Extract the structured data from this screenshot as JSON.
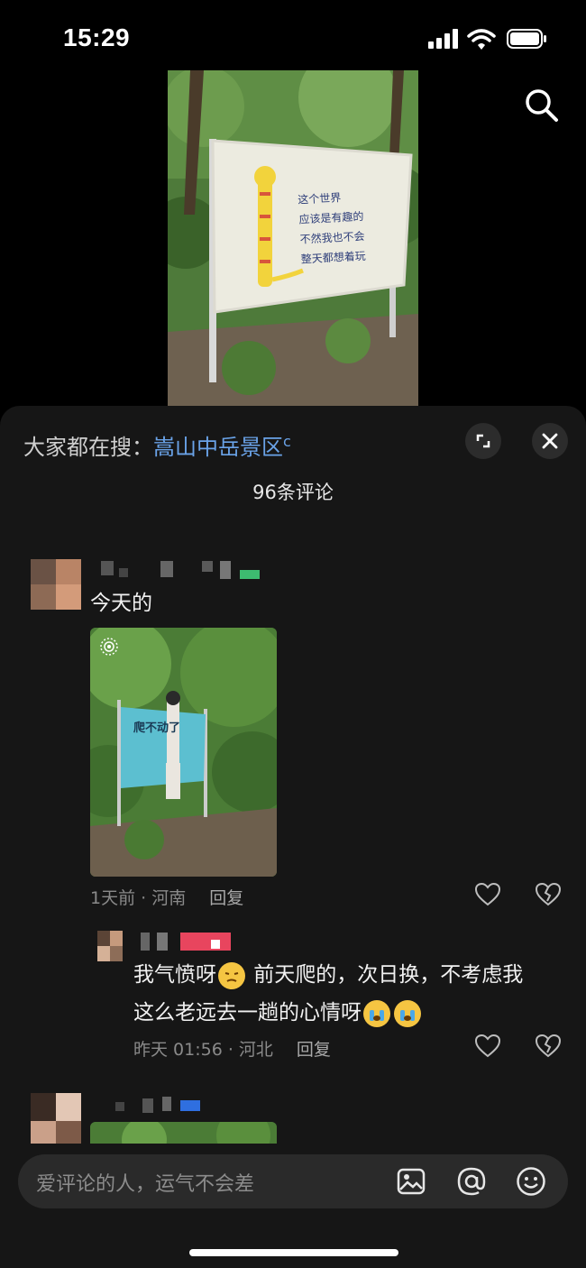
{
  "status_bar": {
    "time": "15:29"
  },
  "header": {
    "hot_search_prefix": "大家都在搜：",
    "hot_search_keyword": "嵩山中岳景区",
    "comment_count": "96条评论"
  },
  "sign": {
    "lines": [
      "这个世界",
      "应该是有趣的",
      "不然我也不会",
      "整天都想着玩"
    ]
  },
  "comments": [
    {
      "text": "今天的",
      "time_location": "1天前 · 河南",
      "reply_label": "回复",
      "photo_sign_title": "爬不动了"
    },
    {
      "text_a": "我气愤呀",
      "text_b": " 前天爬的，次日换，不考虑我",
      "text_c": "这么老远去一趟的心情呀",
      "time_location": "昨天 01:56 · 河北",
      "reply_label": "回复"
    }
  ],
  "input": {
    "placeholder": "爱评论的人，运气不会差"
  },
  "icons": [
    "signal-icon",
    "wifi-icon",
    "battery-icon",
    "search-icon",
    "expand-icon",
    "close-icon",
    "like-icon",
    "dislike-icon",
    "image-icon",
    "mention-icon",
    "emoji-icon"
  ]
}
